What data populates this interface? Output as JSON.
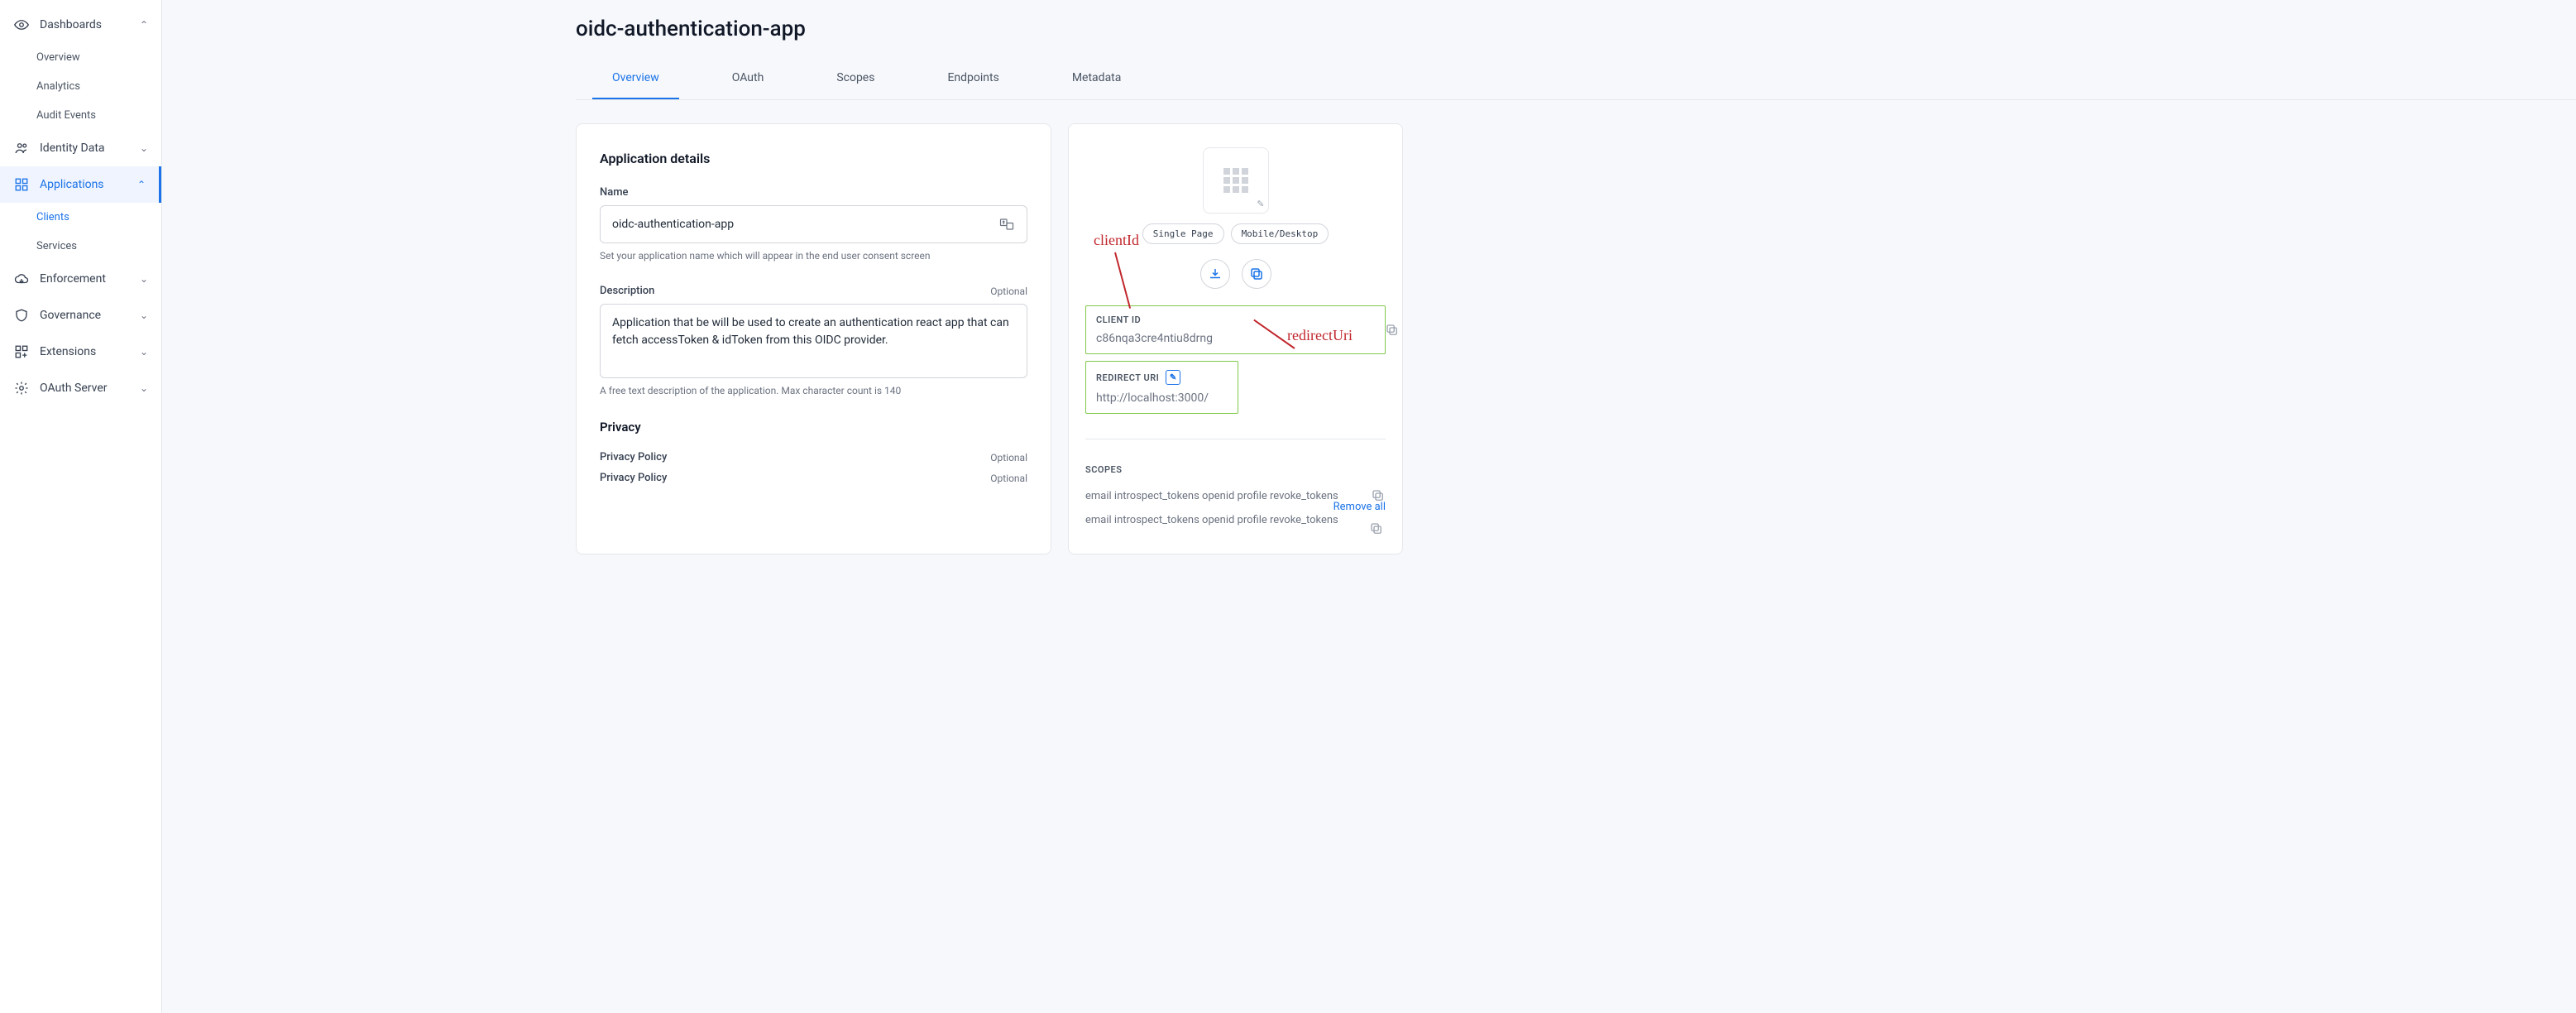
{
  "sidebar": {
    "dashboards": {
      "label": "Dashboards",
      "items": [
        "Overview",
        "Analytics",
        "Audit Events"
      ]
    },
    "identity": {
      "label": "Identity Data"
    },
    "applications": {
      "label": "Applications",
      "items": [
        "Clients",
        "Services"
      ]
    },
    "enforcement": {
      "label": "Enforcement"
    },
    "governance": {
      "label": "Governance"
    },
    "extensions": {
      "label": "Extensions"
    },
    "oauth": {
      "label": "OAuth Server"
    }
  },
  "page": {
    "title": "oidc-authentication-app"
  },
  "tabs": [
    "Overview",
    "OAuth",
    "Scopes",
    "Endpoints",
    "Metadata"
  ],
  "details": {
    "section_title": "Application details",
    "name_label": "Name",
    "name_value": "oidc-authentication-app",
    "name_helper": "Set your application name which will appear in the end user consent screen",
    "desc_label": "Description",
    "desc_optional": "Optional",
    "desc_value": "Application that be will be used to create an authentication react app that can fetch accessToken & idToken from this OIDC provider.",
    "desc_helper": "A free text description of the application. Max character count is 140",
    "privacy_title": "Privacy",
    "privacy_policy_label": "Privacy Policy",
    "privacy_policy_optional": "Optional"
  },
  "side": {
    "pills": [
      "Single Page",
      "Mobile/Desktop"
    ],
    "client_id_label": "CLIENT ID",
    "client_id_value": "c86nqa3cre4ntiu8drng",
    "redirect_label": "REDIRECT URI",
    "redirect_value": "http://localhost:3000/",
    "remove_all": "Remove all",
    "scopes_label": "SCOPES",
    "scopes_text": "email introspect_tokens openid profile revoke_tokens"
  },
  "annotations": {
    "client_id": "clientId",
    "redirect_uri": "redirectUri"
  }
}
